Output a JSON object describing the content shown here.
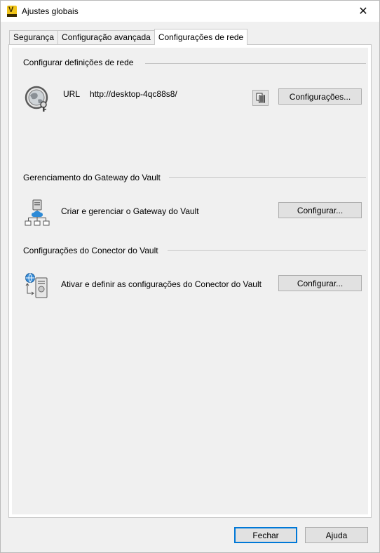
{
  "window": {
    "title": "Ajustes globais",
    "close_glyph": "✕"
  },
  "tabs": [
    {
      "label": "Segurança",
      "active": false
    },
    {
      "label": "Configuração avançada",
      "active": false
    },
    {
      "label": "Configurações de rede",
      "active": true
    }
  ],
  "network": {
    "group_title": "Configurar definições de rede",
    "url_label": "URL",
    "url_value": "http://desktop-4qc88s8/",
    "settings_button": "Configurações...",
    "icon": "network-globe-icon",
    "copy_icon": "copy-icon"
  },
  "gateway": {
    "group_title": "Gerenciamento do Gateway do Vault",
    "description": "Criar e gerenciar o Gateway do Vault",
    "configure_button": "Configurar...",
    "icon": "gateway-network-icon"
  },
  "connector": {
    "group_title": "Configurações do Conector do Vault",
    "description": "Ativar e definir as configurações do Conector do Vault",
    "configure_button": "Configurar...",
    "icon": "connector-server-icon"
  },
  "footer": {
    "close_button": "Fechar",
    "help_button": "Ajuda"
  },
  "colors": {
    "accent": "#0078d7",
    "app_icon": "#f0c419"
  }
}
